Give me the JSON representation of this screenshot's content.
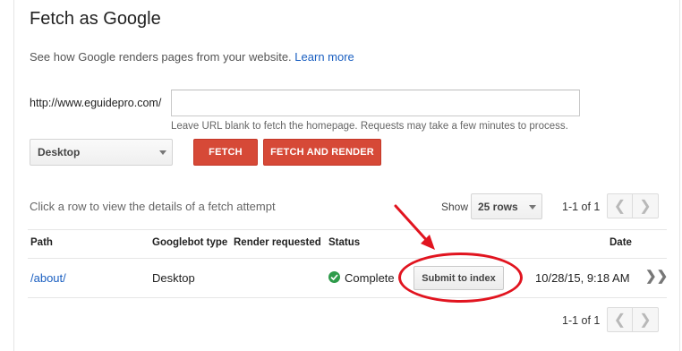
{
  "page": {
    "title": "Fetch as Google",
    "description": "See how Google renders pages from your website.",
    "learn_more": "Learn more"
  },
  "fetch_form": {
    "url_prefix": "http://www.eguidepro.com/",
    "url_value": "",
    "url_placeholder": "",
    "hint": "Leave URL blank to fetch the homepage. Requests may take a few minutes to process.",
    "device_selected": "Desktop",
    "fetch_label": "FETCH",
    "fetch_render_label": "FETCH AND RENDER"
  },
  "results": {
    "row_hint": "Click a row to view the details of a fetch attempt",
    "show_label": "Show",
    "rows_selected": "25 rows",
    "pager_text": "1-1 of 1",
    "columns": {
      "path": "Path",
      "googlebot_type": "Googlebot type",
      "render_requested": "Render requested",
      "status": "Status",
      "date": "Date"
    },
    "rows": [
      {
        "path": "/about/",
        "googlebot_type": "Desktop",
        "render_requested": "",
        "status": "Complete",
        "submit_label": "Submit to index",
        "date": "10/28/15, 9:18 AM"
      }
    ]
  },
  "annotation": {
    "color": "#e1141f"
  },
  "icons": [
    "chevron-left-icon",
    "chevron-right-icon",
    "check-circle-icon",
    "double-chevron-right-icon",
    "caret-down-icon"
  ],
  "colors": {
    "primary_red": "#d64937",
    "link_blue": "#1a5fc1",
    "status_green": "#2e9b4a"
  }
}
